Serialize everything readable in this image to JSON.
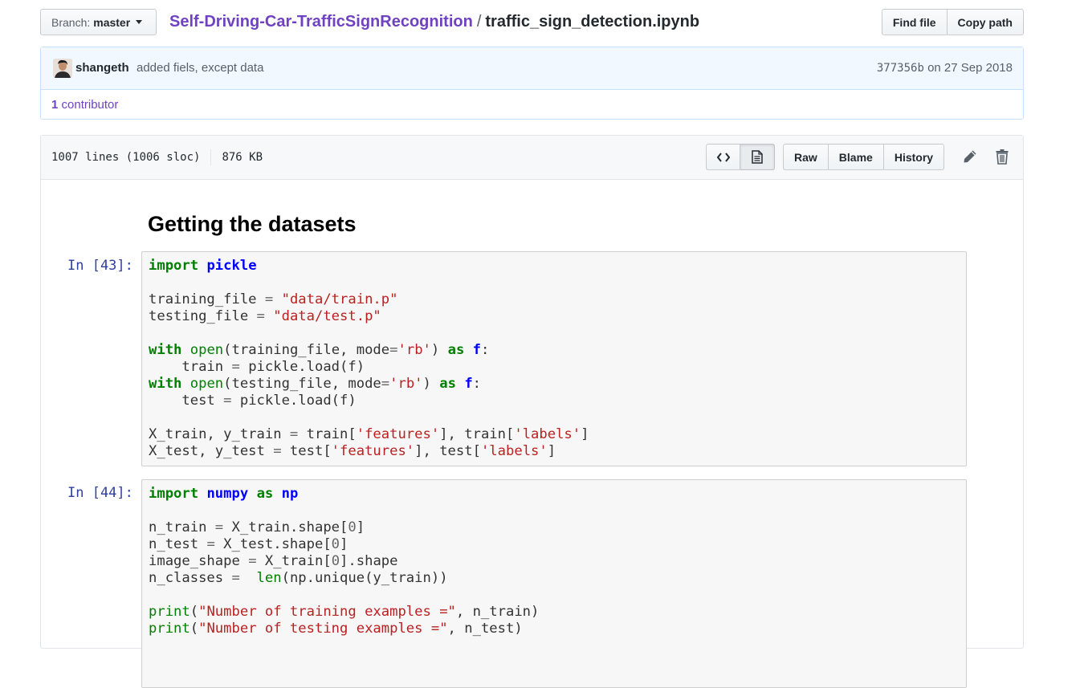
{
  "nav": {
    "branch_label": "Branch:",
    "branch_name": "master",
    "repo": "Self-Driving-Car-TrafficSignRecognition",
    "separator": "/",
    "file": "traffic_sign_detection.ipynb",
    "find_file": "Find file",
    "copy_path": "Copy path"
  },
  "commit": {
    "author": "shangeth",
    "message": "added fiels, except data",
    "sha": "377356b",
    "date": "on 27 Sep 2018",
    "contributors_count": "1",
    "contributors_label": "contributor"
  },
  "file": {
    "lines": "1007 lines (1006 sloc)",
    "size": "876 KB",
    "raw": "Raw",
    "blame": "Blame",
    "history": "History"
  },
  "notebook": {
    "heading": "Getting the datasets",
    "cells": [
      {
        "prompt": "In [43]:",
        "lines": [
          "import pickle",
          "",
          "training_file = \"data/train.p\"",
          "testing_file = \"data/test.p\"",
          "",
          "with open(training_file, mode='rb') as f:",
          "    train = pickle.load(f)",
          "with open(testing_file, mode='rb') as f:",
          "    test = pickle.load(f)",
          "",
          "X_train, y_train = train['features'], train['labels']",
          "X_test, y_test = test['features'], test['labels']"
        ]
      },
      {
        "prompt": "In [44]:",
        "lines": [
          "import numpy as np",
          "",
          "n_train = X_train.shape[0]",
          "n_test = X_test.shape[0]",
          "image_shape = X_train[0].shape",
          "n_classes =  len(np.unique(y_train))",
          "",
          "print(\"Number of training examples =\", n_train)",
          "print(\"Number of testing examples =\", n_test)"
        ]
      }
    ]
  },
  "colors": {
    "link": "#6f42c1",
    "prompt": "#303f9f",
    "keyword": "#008000",
    "string": "#ba2121",
    "module": "#0000ff"
  },
  "icons": [
    "caret-down-icon",
    "code-icon",
    "file-icon",
    "pencil-icon",
    "trash-icon",
    "avatar"
  ]
}
